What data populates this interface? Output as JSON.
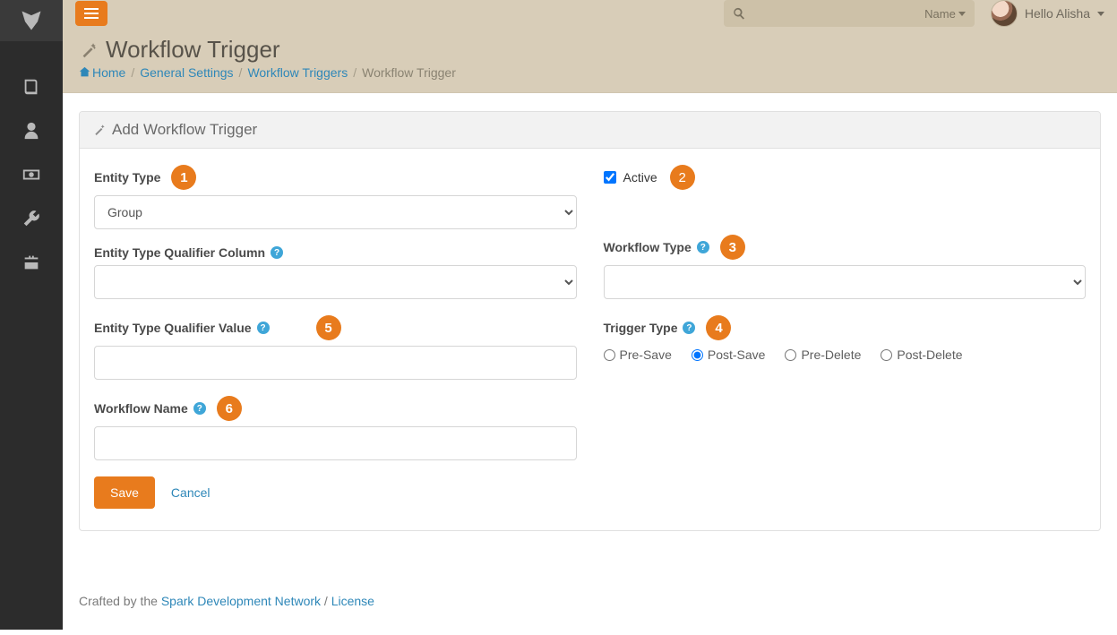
{
  "topbar": {
    "search_placeholder": "",
    "search_type_label": "Name",
    "greeting": "Hello Alisha"
  },
  "page": {
    "title": "Workflow Trigger",
    "breadcrumb": {
      "home": "Home",
      "general_settings": "General Settings",
      "workflow_triggers": "Workflow Triggers",
      "current": "Workflow Trigger"
    }
  },
  "panel": {
    "title": "Add Workflow Trigger"
  },
  "fields": {
    "entity_type": {
      "label": "Entity Type",
      "value": "Group"
    },
    "entity_type_qualifier_column": {
      "label": "Entity Type Qualifier Column",
      "value": ""
    },
    "entity_type_qualifier_value": {
      "label": "Entity Type Qualifier Value",
      "value": ""
    },
    "workflow_name": {
      "label": "Workflow Name",
      "value": ""
    },
    "active": {
      "label": "Active",
      "checked": true
    },
    "workflow_type": {
      "label": "Workflow Type",
      "value": ""
    },
    "trigger_type": {
      "label": "Trigger Type",
      "options": [
        "Pre-Save",
        "Post-Save",
        "Pre-Delete",
        "Post-Delete"
      ],
      "selected": "Post-Save"
    }
  },
  "callouts": {
    "c1": "1",
    "c2": "2",
    "c3": "3",
    "c4": "4",
    "c5": "5",
    "c6": "6"
  },
  "actions": {
    "save": "Save",
    "cancel": "Cancel"
  },
  "footer": {
    "prefix": "Crafted by the ",
    "spark": "Spark Development Network",
    "sep": " / ",
    "license": "License"
  }
}
